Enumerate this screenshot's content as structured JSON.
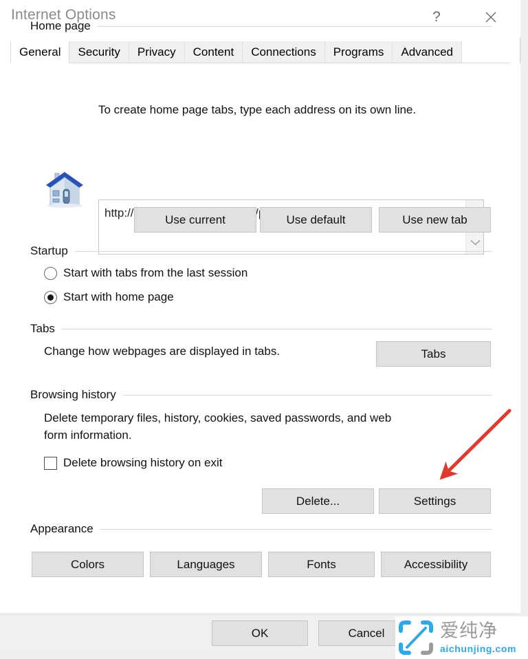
{
  "window": {
    "title": "Internet Options",
    "help_icon": "question-mark-icon",
    "help_label": "?",
    "close_icon": "close-icon"
  },
  "tabs": [
    {
      "label": "General",
      "active": true
    },
    {
      "label": "Security",
      "active": false
    },
    {
      "label": "Privacy",
      "active": false
    },
    {
      "label": "Content",
      "active": false
    },
    {
      "label": "Connections",
      "active": false
    },
    {
      "label": "Programs",
      "active": false
    },
    {
      "label": "Advanced",
      "active": false
    }
  ],
  "home_page": {
    "group_label": "Home page",
    "icon": "house-icon",
    "description": "To create home page tabs, type each address on its own line.",
    "textarea_value": "http://go.microsoft.com/fwlink/p/?LinkId=255141",
    "scroll_up_icon": "chevron-up-icon",
    "scroll_down_icon": "chevron-down-icon",
    "buttons": [
      {
        "label": "Use current"
      },
      {
        "label": "Use default"
      },
      {
        "label": "Use new tab"
      }
    ]
  },
  "startup": {
    "group_label": "Startup",
    "options": [
      {
        "label": "Start with tabs from the last session",
        "selected": false
      },
      {
        "label": "Start with home page",
        "selected": true
      }
    ]
  },
  "tabs_section": {
    "group_label": "Tabs",
    "description": "Change how webpages are displayed in tabs.",
    "button_label": "Tabs"
  },
  "browsing_history": {
    "group_label": "Browsing history",
    "description_line1": "Delete temporary files, history, cookies, saved passwords, and web",
    "description_line2": "form information.",
    "checkbox_label": "Delete browsing history on exit",
    "checkbox_checked": false,
    "delete_button_label": "Delete...",
    "settings_button_label": "Settings"
  },
  "appearance": {
    "group_label": "Appearance",
    "buttons": [
      {
        "label": "Colors"
      },
      {
        "label": "Languages"
      },
      {
        "label": "Fonts"
      },
      {
        "label": "Accessibility"
      }
    ]
  },
  "footer": {
    "ok_label": "OK",
    "cancel_label": "Cancel"
  },
  "annotation": {
    "type": "arrow",
    "color": "#e03a2f",
    "points_to": "settings-button"
  },
  "watermark": {
    "logo_icon": "aichunjing-logo-icon",
    "brand_cn": "爱纯净",
    "domain": "aichunjing.com",
    "brand_color": "#2fa8e8"
  }
}
